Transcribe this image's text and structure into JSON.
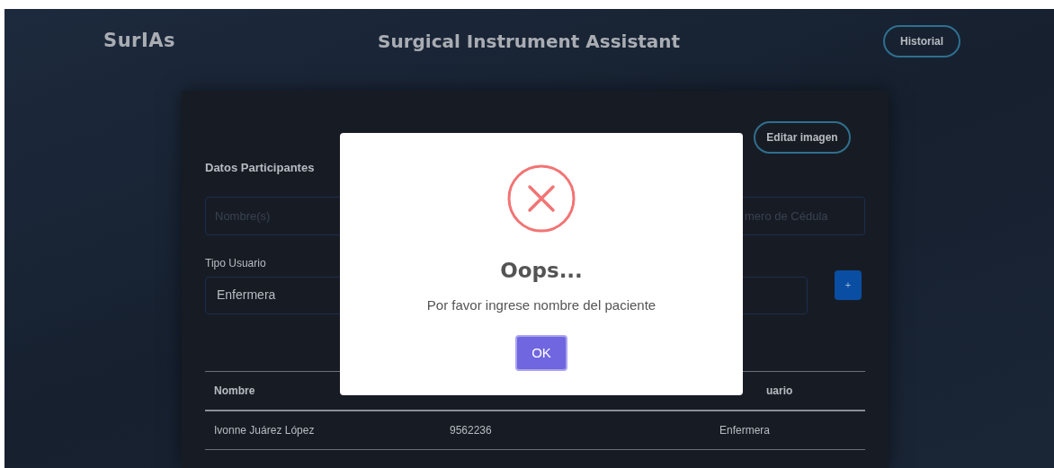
{
  "header": {
    "brand": "SurIAs",
    "title": "Surgical Instrument Assistant",
    "history_button": "Historial"
  },
  "card": {
    "edit_image_button": "Editar imagen",
    "section_title": "Datos Participantes",
    "name_field": {
      "placeholder": "Nombre(s)"
    },
    "id_field": {
      "placeholder": "mero de Cédula"
    },
    "user_type": {
      "label": "Tipo Usuario",
      "value": "Enfermera"
    },
    "add_button": "+",
    "table": {
      "header": {
        "column_1": "Nombre",
        "column_3": "uario"
      },
      "rows": [
        {
          "column_1": "Ivonne Juárez López",
          "column_2": "9562236",
          "column_3": "Enfermera"
        }
      ]
    }
  },
  "dialog": {
    "kind": "error",
    "title": "Oops...",
    "message": "Por favor ingrese nombre del paciente",
    "ok_button": "OK"
  }
}
